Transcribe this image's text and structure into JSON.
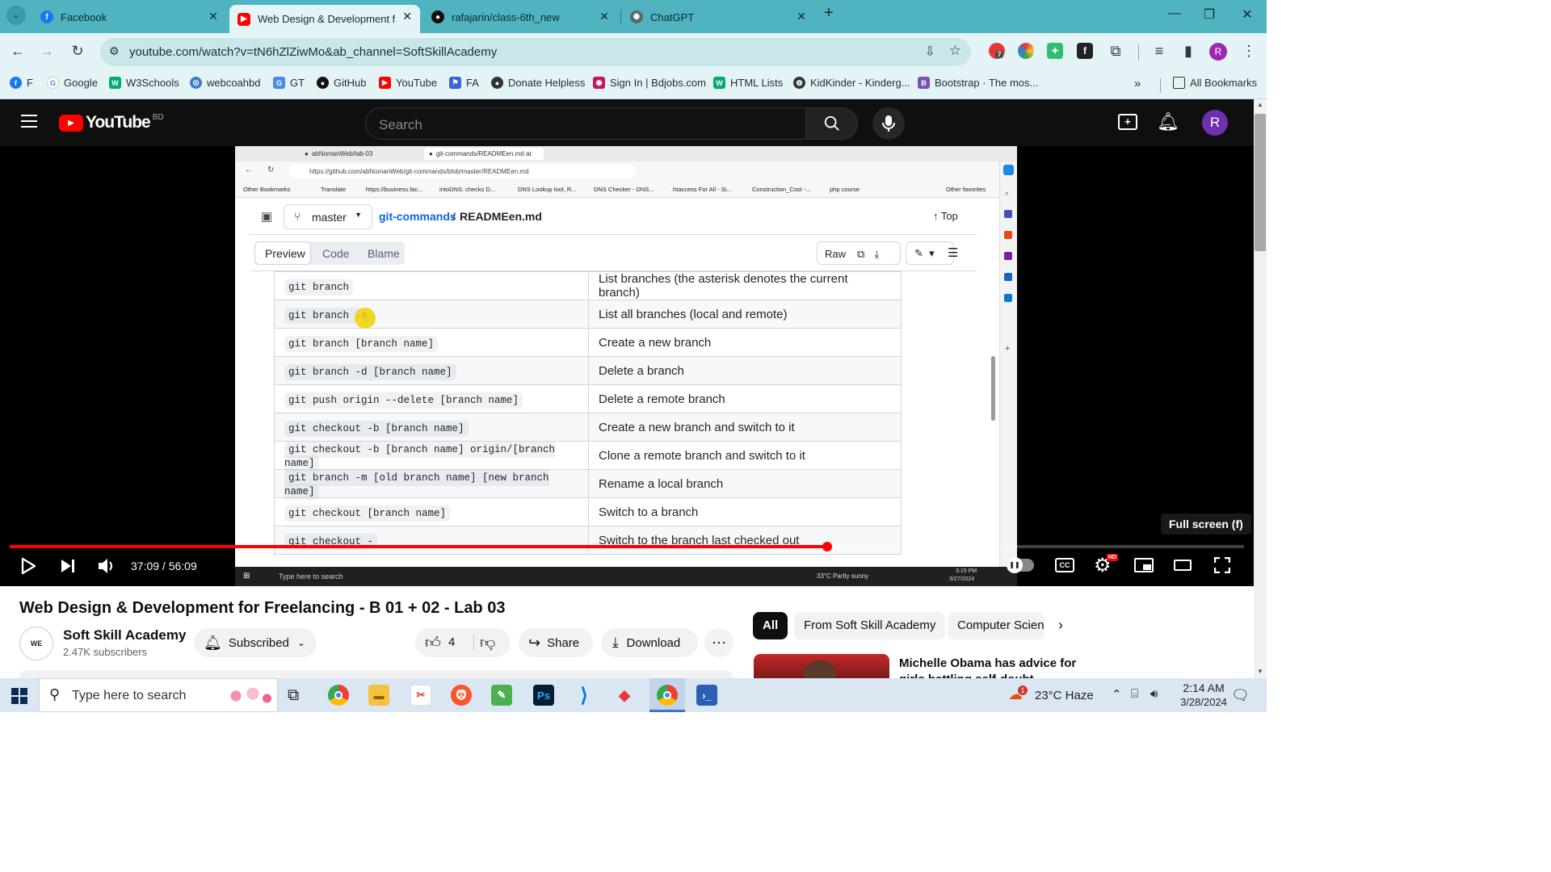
{
  "browser": {
    "tabs": [
      {
        "title": "Facebook",
        "icon": "facebook-icon",
        "color": "#1877f2"
      },
      {
        "title": "Web Design & Development fo",
        "icon": "youtube-icon",
        "color": "#ff0000"
      },
      {
        "title": "rafajarin/class-6th_new",
        "icon": "github-icon",
        "color": "#111111"
      },
      {
        "title": "ChatGPT",
        "icon": "chatgpt-icon",
        "color": "#4a4a4a"
      }
    ],
    "url": "youtube.com/watch?v=tN6hZlZiwMo&ab_channel=SoftSkillAcademy",
    "extension_badge": "7",
    "profile_initial": "R",
    "bookmarks": [
      {
        "label": "F",
        "icon": "facebook-icon",
        "color": "#1877f2"
      },
      {
        "label": "Google",
        "icon": "google-icon",
        "color": "#4285f4"
      },
      {
        "label": "W3Schools",
        "icon": "w3schools-icon",
        "color": "#04aa6d"
      },
      {
        "label": "webcoahbd",
        "icon": "webcoahbd-icon",
        "color": "#3f7cc8"
      },
      {
        "label": "GT",
        "icon": "google-translate-icon",
        "color": "#4a8ae8"
      },
      {
        "label": "GitHub",
        "icon": "github-icon",
        "color": "#111111"
      },
      {
        "label": "YouTube",
        "icon": "youtube-icon",
        "color": "#ff0000"
      },
      {
        "label": "FA",
        "icon": "flag-icon",
        "color": "#3f62d4"
      },
      {
        "label": "Donate Helpless",
        "icon": "donate-icon",
        "color": "#333333"
      },
      {
        "label": "Sign In | Bdjobs.com",
        "icon": "bdjobs-icon",
        "color": "#c2185b"
      },
      {
        "label": "HTML Lists",
        "icon": "w3schools-icon",
        "color": "#04aa6d"
      },
      {
        "label": "KidKinder - Kinderg...",
        "icon": "globe-icon",
        "color": "#333333"
      },
      {
        "label": "Bootstrap · The mos...",
        "icon": "bootstrap-icon",
        "color": "#7952b3"
      }
    ],
    "all_bookmarks": "All Bookmarks"
  },
  "youtube": {
    "logo_text": "YouTube",
    "region": "BD",
    "search_placeholder": "Search",
    "avatar_initial": "R"
  },
  "inner_screen": {
    "tabs": [
      "abNomanWeb/lab-03",
      "git-commands/READMEen.md at"
    ],
    "url": "https://github.com/abNomanWeb/git-commands/blob/master/READMEen.md",
    "bookmarks": [
      "Other Bookmarks",
      "Translate",
      "https://business.fac...",
      "intoDNS: checks D...",
      "DNS Lookup tool, R...",
      "DNS Checker - DNS...",
      ".htaccess For All - Si...",
      "Construction_Cost -...",
      "php course",
      "Other favorites"
    ],
    "branch": "master",
    "repo": "git-commands",
    "sep": "/",
    "file": "READMEen.md",
    "top_label": "Top",
    "view_tabs": [
      "Preview",
      "Code",
      "Blame"
    ],
    "raw_label": "Raw",
    "rows": [
      {
        "cmd": "git branch",
        "desc": "List branches (the asterisk denotes the current branch)"
      },
      {
        "cmd": "git branch -a",
        "desc": "List all branches (local and remote)"
      },
      {
        "cmd": "git branch [branch name]",
        "desc": "Create a new branch"
      },
      {
        "cmd": "git branch -d [branch name]",
        "desc": "Delete a branch"
      },
      {
        "cmd": "git push origin --delete [branch name]",
        "desc": "Delete a remote branch"
      },
      {
        "cmd": "git checkout -b [branch name]",
        "desc": "Create a new branch and switch to it"
      },
      {
        "cmd": "git checkout -b [branch name] origin/[branch name]",
        "desc": "Clone a remote branch and switch to it"
      },
      {
        "cmd": "git branch -m [old branch name] [new branch name]",
        "desc": "Rename a local branch"
      },
      {
        "cmd": "git checkout [branch name]",
        "desc": "Switch to a branch"
      },
      {
        "cmd": "git checkout -",
        "desc": "Switch to the branch last checked out"
      }
    ],
    "taskbar_search": "Type here to search",
    "weather": "33°C  Partly sunny",
    "time": "3:15 PM",
    "date": "3/27/2024"
  },
  "player": {
    "time": "37:09 / 56:09",
    "progress_fraction": 0.662,
    "buffered_fraction": 0.685,
    "fullscreen_tooltip": "Full screen (f)",
    "hd_badge": "HD"
  },
  "video": {
    "title": "Web Design & Development for Freelancing - B 01 + 02 - Lab 03",
    "channel": "Soft Skill Academy",
    "subscribers": "2.47K subscribers",
    "subscribed_label": "Subscribed",
    "likes": "4",
    "share_label": "Share",
    "download_label": "Download"
  },
  "chips": [
    "All",
    "From Soft Skill Academy",
    "Computer Scien"
  ],
  "recommended": {
    "title_line1": "Michelle Obama has advice for",
    "title_line2": "girls battling self-doubt"
  },
  "taskbar": {
    "search_placeholder": "Type here to search",
    "weather": "23°C  Haze",
    "weather_badge": "1",
    "time": "2:14 AM",
    "date": "3/28/2024"
  }
}
